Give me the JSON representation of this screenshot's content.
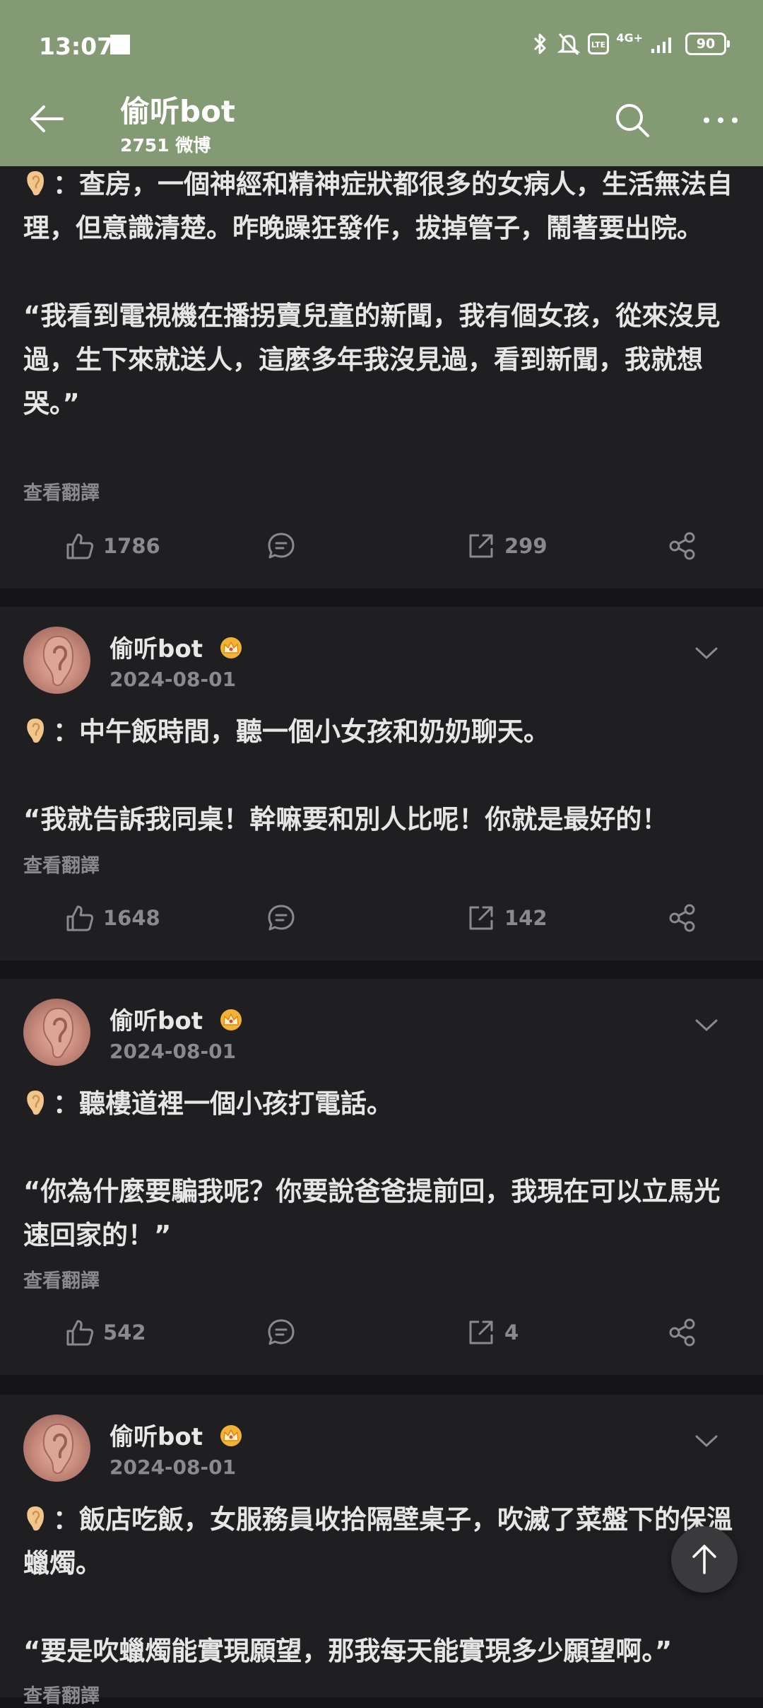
{
  "status_bar": {
    "time": "13:07",
    "network": "4G+",
    "battery": "90"
  },
  "header": {
    "title": "偷听bot",
    "subtitle": "2751 微博"
  },
  "posts": [
    {
      "username": "",
      "date": "",
      "paragraphs": [
        "：查房，一個神經和精神症狀都很多的女病人，生活無法自理，但意識清楚。昨晚躁狂發作，拔掉管子，鬧著要出院。",
        "“我看到電視機在播拐賣兒童的新聞，我有個女孩，從來沒見過，生下來就送人，這麼多年我沒見過，看到新聞，我就想哭。”"
      ],
      "translate": "查看翻譯",
      "likes": "1786",
      "reposts": "299"
    },
    {
      "username": "偷听bot",
      "date": "2024-08-01",
      "paragraphs": [
        "：中午飯時間，聽一個小女孩和奶奶聊天。",
        "“我就告訴我同桌！幹嘛要和別人比呢！你就是最好的！"
      ],
      "translate": "查看翻譯",
      "likes": "1648",
      "reposts": "142"
    },
    {
      "username": "偷听bot",
      "date": "2024-08-01",
      "paragraphs": [
        "：聽樓道裡一個小孩打電話。",
        "“你為什麼要騙我呢？你要說爸爸提前回，我現在可以立馬光速回家的！”"
      ],
      "translate": "查看翻譯",
      "likes": "542",
      "reposts": "4"
    },
    {
      "username": "偷听bot",
      "date": "2024-08-01",
      "paragraphs": [
        "：飯店吃飯，女服務員收拾隔壁桌子，吹滅了菜盤下的保溫蠟燭。",
        "“要是吹蠟燭能實現願望，那我每天能實現多少願望啊。”"
      ],
      "translate": "查看翻譯"
    }
  ],
  "colors": {
    "header_bg": "#849a74",
    "card_bg": "#1f1f22",
    "page_bg": "#141416",
    "muted": "#8a8a8d"
  }
}
